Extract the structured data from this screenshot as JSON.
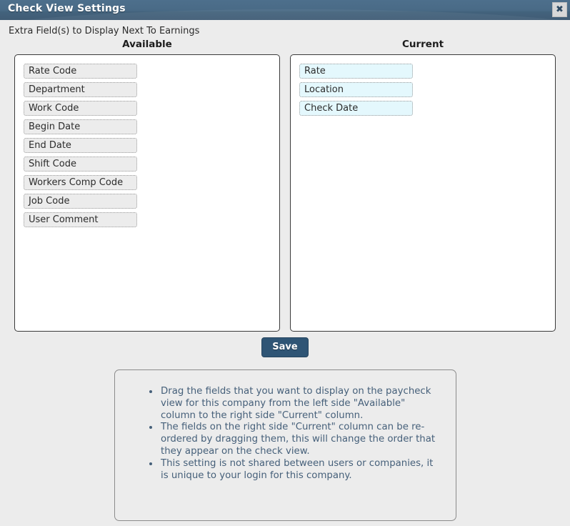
{
  "window": {
    "title": "Check View Settings",
    "close_icon": "close-icon",
    "close_glyph": "✖"
  },
  "header": {
    "subtitle": "Extra Field(s) to Display Next To Earnings",
    "available_label": "Available",
    "current_label": "Current"
  },
  "available": {
    "items": [
      {
        "label": "Rate Code"
      },
      {
        "label": "Department"
      },
      {
        "label": "Work Code"
      },
      {
        "label": "Begin Date"
      },
      {
        "label": "End Date"
      },
      {
        "label": "Shift Code"
      },
      {
        "label": "Workers Comp Code"
      },
      {
        "label": "Job Code"
      },
      {
        "label": "User Comment"
      }
    ]
  },
  "current": {
    "items": [
      {
        "label": "Rate"
      },
      {
        "label": "Location"
      },
      {
        "label": "Check Date"
      }
    ]
  },
  "actions": {
    "save_label": "Save"
  },
  "instructions": {
    "bullets": [
      "Drag the fields that you want to display on the paycheck view for this company from the left side \"Available\" column to the right side \"Current\" column.",
      "The fields on the right side \"Current\" column can be re-ordered by dragging them, this will change the order that they appear on the check view.",
      "This setting is not shared between users or companies, it is unique to your login for this company."
    ]
  },
  "colors": {
    "titlebar": "#4a6b87",
    "save_button": "#2f5575",
    "current_item_bg": "#e4f8fd",
    "available_item_bg": "#ececec",
    "instruction_text": "#46607a"
  }
}
